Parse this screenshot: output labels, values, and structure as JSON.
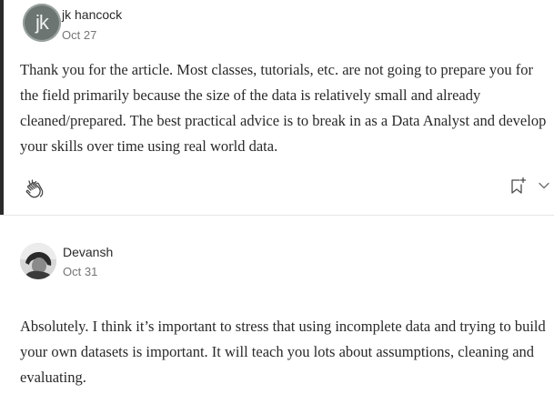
{
  "comments": [
    {
      "author": "jk hancock",
      "avatar_initials": "jk",
      "date": "Oct 27",
      "text": "Thank you for the article. Most classes, tutorials, etc. are not going to prepare you for the field primarily because the size of the data is relatively small and already cleaned/prepared. The best practical advice is to break in as a Data Analyst and develop your skills over time using real world data."
    },
    {
      "author": "Devansh",
      "date": "Oct 31",
      "text": "Absolutely. I think it’s important to stress that using incomplete data and trying to build your own datasets is important. It will teach you lots about assumptions, cleaning and evaluating."
    }
  ],
  "icons": {
    "clap": "clap-icon",
    "bookmark": "bookmark-add-icon",
    "more": "chevron-down-icon"
  },
  "colors": {
    "thread_bar": "#2a2a2a",
    "text": "#292929",
    "meta": "#757575"
  }
}
